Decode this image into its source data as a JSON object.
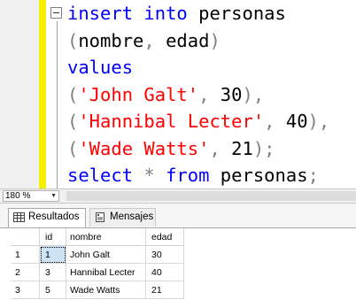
{
  "editor": {
    "code_lines": [
      [
        {
          "t": "insert",
          "c": "kw"
        },
        {
          "t": " ",
          "c": ""
        },
        {
          "t": "into",
          "c": "kw"
        },
        {
          "t": " personas",
          "c": ""
        }
      ],
      [
        {
          "t": "(",
          "c": "gr"
        },
        {
          "t": "nombre",
          "c": ""
        },
        {
          "t": ",",
          "c": "gr"
        },
        {
          "t": " edad",
          "c": ""
        },
        {
          "t": ")",
          "c": "gr"
        }
      ],
      [
        {
          "t": "values",
          "c": "kw"
        }
      ],
      [
        {
          "t": "(",
          "c": "gr"
        },
        {
          "t": "'John Galt'",
          "c": "str"
        },
        {
          "t": ",",
          "c": "gr"
        },
        {
          "t": " 30",
          "c": ""
        },
        {
          "t": "),",
          "c": "gr"
        }
      ],
      [
        {
          "t": "(",
          "c": "gr"
        },
        {
          "t": "'Hannibal Lecter'",
          "c": "str"
        },
        {
          "t": ",",
          "c": "gr"
        },
        {
          "t": " 40",
          "c": ""
        },
        {
          "t": "),",
          "c": "gr"
        }
      ],
      [
        {
          "t": "(",
          "c": "gr"
        },
        {
          "t": "'Wade Watts'",
          "c": "str"
        },
        {
          "t": ",",
          "c": "gr"
        },
        {
          "t": " 21",
          "c": ""
        },
        {
          "t": ");",
          "c": "gr"
        }
      ],
      [
        {
          "t": "select",
          "c": "kw"
        },
        {
          "t": " ",
          "c": ""
        },
        {
          "t": "*",
          "c": "op"
        },
        {
          "t": " ",
          "c": ""
        },
        {
          "t": "from",
          "c": "kw"
        },
        {
          "t": " personas",
          "c": ""
        },
        {
          "t": ";",
          "c": "gr"
        }
      ]
    ]
  },
  "zoom": {
    "value": "180 %"
  },
  "tabs": {
    "results": "Resultados",
    "messages": "Mensajes"
  },
  "grid": {
    "columns": [
      "",
      "id",
      "nombre",
      "edad"
    ],
    "rows": [
      [
        "1",
        "1",
        "John Galt",
        "30"
      ],
      [
        "2",
        "3",
        "Hannibal Lecter",
        "40"
      ],
      [
        "3",
        "5",
        "Wade Watts",
        "21"
      ]
    ]
  },
  "colors": {
    "keyword": "#0000ff",
    "string": "#ff0000",
    "punct": "#808080",
    "change_bar": "#f6f000",
    "selected_cell": "#cfe3f7"
  }
}
